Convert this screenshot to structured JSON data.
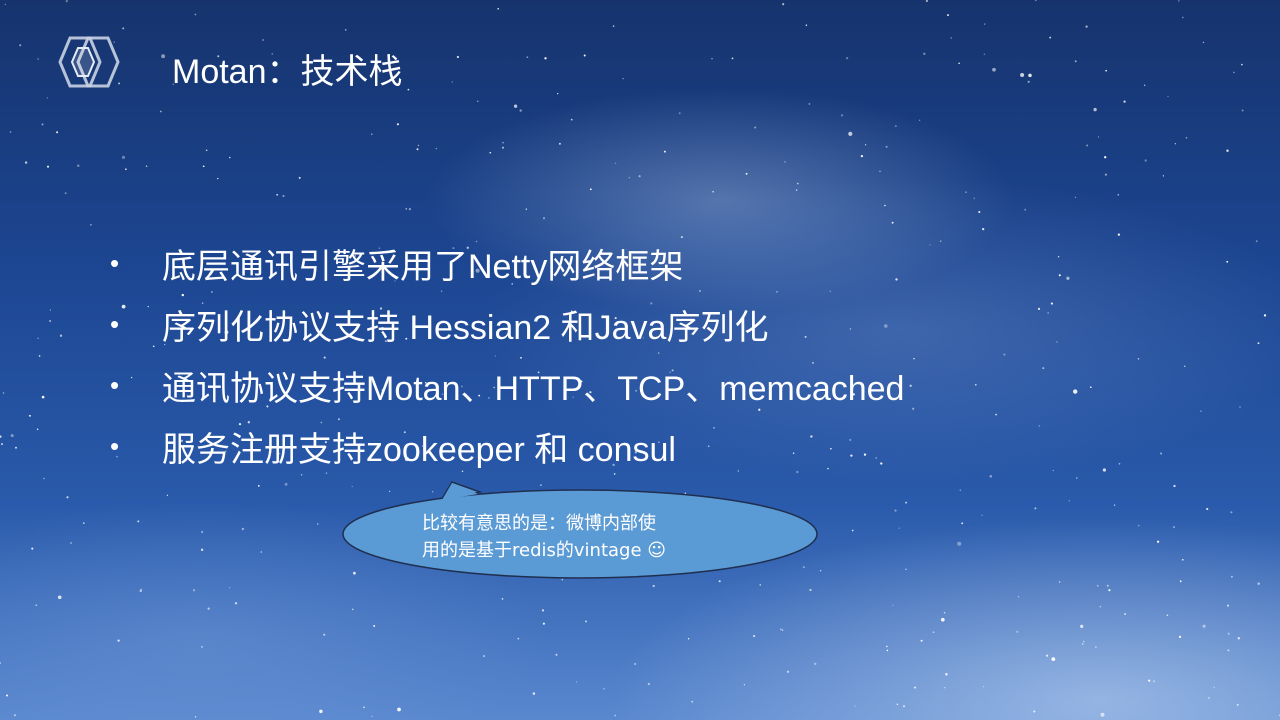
{
  "slide": {
    "title": "Motan：技术栈",
    "bullet_symbol": "•",
    "bullets": [
      {
        "text": "底层通讯引擎采用了Netty网络框架"
      },
      {
        "text": "序列化协议支持 Hessian2 和Java序列化"
      },
      {
        "text": "通讯协议支持Motan、HTTP、TCP、memcached"
      },
      {
        "text": "服务注册支持zookeeper 和 consul"
      }
    ],
    "callout": {
      "line1": "比较有意思的是：微博内部使",
      "line2": "用的是基于redis的vintage ☺"
    }
  },
  "colors": {
    "text": "#ffffff",
    "callout_fill": "#5b9bd5",
    "callout_stroke": "#1f2f4f",
    "logo_stroke": "#c9d3e3"
  },
  "icons": {
    "logo": "hexagon-logo-icon"
  }
}
